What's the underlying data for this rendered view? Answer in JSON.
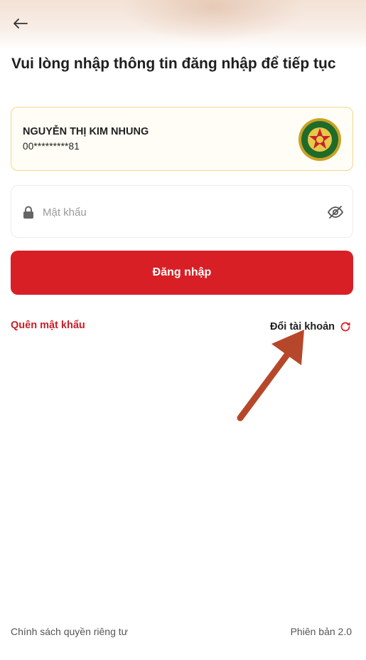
{
  "header": {
    "back_icon": "arrow-left-icon",
    "title": "Vui lòng nhập thông tin đăng nhập để tiếp tục"
  },
  "account": {
    "name": "NGUYỄN THỊ KIM NHUNG",
    "phone": "00*********81",
    "emblem_icon": "emblem-icon"
  },
  "password": {
    "placeholder": "Mật khẩu",
    "value": "",
    "lock_icon": "lock-icon",
    "visibility_icon": "eye-off-icon"
  },
  "actions": {
    "login_label": "Đăng nhập",
    "forgot_label": "Quên mật khẩu",
    "switch_account_label": "Đổi tài khoản",
    "switch_icon": "refresh-icon"
  },
  "footer": {
    "privacy_label": "Chính sách quyền riêng tư",
    "version_label": "Phiên bản 2.0"
  },
  "colors": {
    "primary_red": "#d81f26",
    "card_border": "#f1d88a",
    "annotation_arrow": "#b7472a"
  }
}
